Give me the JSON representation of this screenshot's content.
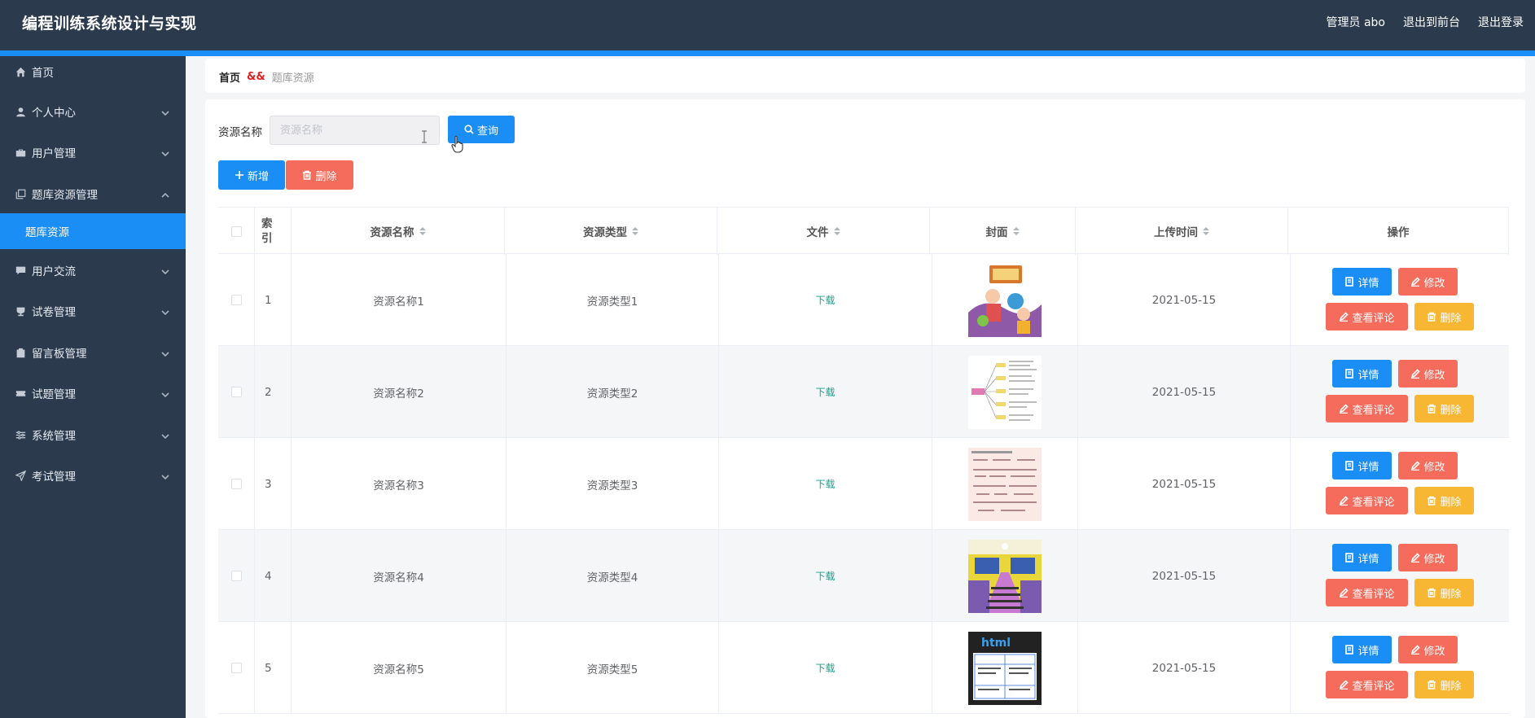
{
  "app": {
    "title": "编程训练系统设计与实现",
    "user_label": "管理员 abo",
    "front_link": "退出到前台",
    "logout_link": "退出登录"
  },
  "sidebar": {
    "items": [
      {
        "label": "首页",
        "icon": "home-icon"
      },
      {
        "label": "个人中心",
        "icon": "user-icon"
      },
      {
        "label": "用户管理",
        "icon": "briefcase-icon"
      },
      {
        "label": "题库资源管理",
        "icon": "copy-icon"
      },
      {
        "label": "题库资源",
        "icon": ""
      },
      {
        "label": "用户交流",
        "icon": "chat-icon"
      },
      {
        "label": "试卷管理",
        "icon": "trophy-icon"
      },
      {
        "label": "留言板管理",
        "icon": "clipboard-icon"
      },
      {
        "label": "试题管理",
        "icon": "ticket-icon"
      },
      {
        "label": "系统管理",
        "icon": "sliders-icon"
      },
      {
        "label": "考试管理",
        "icon": "send-icon"
      }
    ]
  },
  "breadcrumb": {
    "home": "首页",
    "separator": "&&",
    "current": "题库资源"
  },
  "search": {
    "label": "资源名称",
    "placeholder": "资源名称",
    "value": "",
    "button": "查询"
  },
  "toolbar": {
    "add": "新增",
    "delete": "删除"
  },
  "table": {
    "columns": {
      "index": "索引",
      "name": "资源名称",
      "type": "资源类型",
      "file": "文件",
      "cover": "封面",
      "upload_time": "上传时间",
      "actions": "操作"
    },
    "rows": [
      {
        "index": "1",
        "name": "资源名称1",
        "type": "资源类型1",
        "file": "下载",
        "cover": "cartoon-kids-image",
        "upload_time": "2021-05-15"
      },
      {
        "index": "2",
        "name": "资源名称2",
        "type": "资源类型2",
        "file": "下载",
        "cover": "mindmap-image",
        "upload_time": "2021-05-15"
      },
      {
        "index": "3",
        "name": "资源名称3",
        "type": "资源类型3",
        "file": "下载",
        "cover": "notes-sheet-image",
        "upload_time": "2021-05-15"
      },
      {
        "index": "4",
        "name": "资源名称4",
        "type": "资源类型4",
        "file": "下载",
        "cover": "classroom-photo-image",
        "upload_time": "2021-05-15"
      },
      {
        "index": "5",
        "name": "资源名称5",
        "type": "资源类型5",
        "file": "下载",
        "cover": "html-poster-image",
        "upload_time": "2021-05-15"
      }
    ],
    "row_actions": {
      "detail": "详情",
      "edit": "修改",
      "comments": "查看评论",
      "delete": "删除"
    }
  },
  "colors": {
    "header_bg": "#2b3a4d",
    "accent": "#1a8ef5",
    "danger": "#f56c5c",
    "warning": "#f7b733",
    "link": "#1aa08a"
  }
}
